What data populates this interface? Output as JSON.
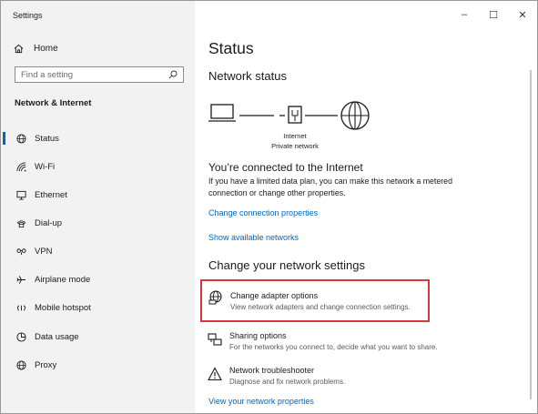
{
  "window": {
    "title": "Settings",
    "minimize": "–",
    "maximize": "☐",
    "close": "✕"
  },
  "sidebar": {
    "home_label": "Home",
    "search_placeholder": "Find a setting",
    "section_title": "Network & Internet",
    "items": [
      {
        "label": "Status",
        "icon": "globe-icon",
        "active": true
      },
      {
        "label": "Wi-Fi",
        "icon": "wifi-icon"
      },
      {
        "label": "Ethernet",
        "icon": "ethernet-icon"
      },
      {
        "label": "Dial-up",
        "icon": "dialup-icon"
      },
      {
        "label": "VPN",
        "icon": "vpn-icon"
      },
      {
        "label": "Airplane mode",
        "icon": "airplane-icon"
      },
      {
        "label": "Mobile hotspot",
        "icon": "hotspot-icon"
      },
      {
        "label": "Data usage",
        "icon": "data-usage-icon"
      },
      {
        "label": "Proxy",
        "icon": "globe-icon"
      }
    ]
  },
  "main": {
    "title": "Status",
    "network_status_heading": "Network status",
    "diagram": {
      "line1": "Internet",
      "line2": "Private network"
    },
    "connected_heading": "You’re connected to the Internet",
    "connected_text": "If you have a limited data plan, you can make this network a metered connection or change other properties.",
    "change_props_link": "Change connection properties",
    "show_networks_link": "Show available networks",
    "change_settings_heading": "Change your network settings",
    "options": [
      {
        "title": "Change adapter options",
        "desc": "View network adapters and change connection settings.",
        "icon": "adapter-globe-icon"
      },
      {
        "title": "Sharing options",
        "desc": "For the networks you connect to, decide what you want to share.",
        "icon": "sharing-icon"
      },
      {
        "title": "Network troubleshooter",
        "desc": "Diagnose and fix network problems.",
        "icon": "warning-icon"
      }
    ],
    "view_properties_link": "View your network properties"
  },
  "colors": {
    "accent": "#0067c0",
    "highlight": "#d7363f",
    "sidebar_bg": "#f2f2f2"
  }
}
